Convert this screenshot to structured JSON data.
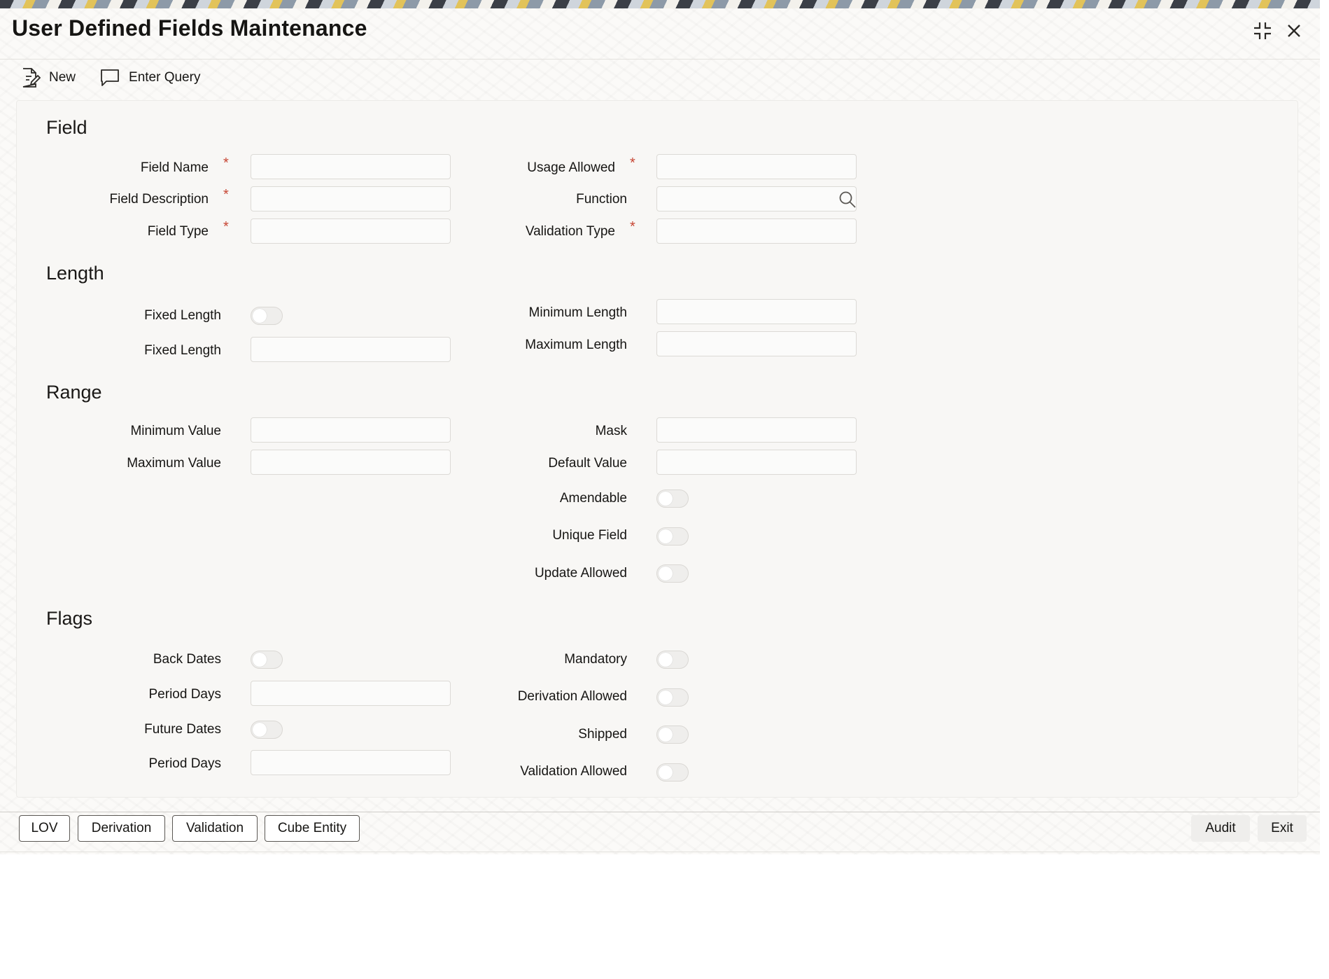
{
  "window": {
    "title": "User Defined Fields Maintenance"
  },
  "toolbar": {
    "new_label": "New",
    "enter_query_label": "Enter Query"
  },
  "sections": {
    "field": "Field",
    "length": "Length",
    "range": "Range",
    "flags": "Flags"
  },
  "field": {
    "field_name": "Field Name",
    "field_description": "Field Description",
    "field_type": "Field Type",
    "usage_allowed": "Usage Allowed",
    "function": "Function",
    "validation_type": "Validation Type",
    "required_marker": "*"
  },
  "length": {
    "fixed_length_toggle": "Fixed Length",
    "fixed_length_input": "Fixed Length",
    "minimum_length": "Minimum Length",
    "maximum_length": "Maximum Length"
  },
  "range": {
    "minimum_value": "Minimum Value",
    "maximum_value": "Maximum Value",
    "mask": "Mask",
    "default_value": "Default Value",
    "amendable": "Amendable",
    "unique_field": "Unique Field",
    "update_allowed": "Update Allowed"
  },
  "flags": {
    "back_dates": "Back Dates",
    "period_days_1": "Period Days",
    "future_dates": "Future Dates",
    "period_days_2": "Period Days",
    "mandatory": "Mandatory",
    "derivation_allowed": "Derivation Allowed",
    "shipped": "Shipped",
    "validation_allowed": "Validation Allowed"
  },
  "footer": {
    "lov": "LOV",
    "derivation": "Derivation",
    "validation": "Validation",
    "cube_entity": "Cube Entity",
    "audit": "Audit",
    "exit": "Exit"
  },
  "colors": {
    "required": "#c74634",
    "panel": "#f8f7f5"
  }
}
